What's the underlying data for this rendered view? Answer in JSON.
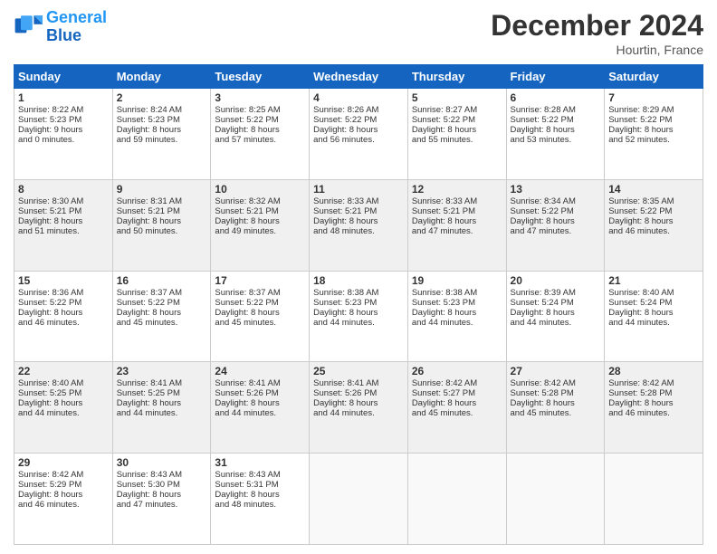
{
  "header": {
    "logo_line1": "General",
    "logo_line2": "Blue",
    "month_title": "December 2024",
    "location": "Hourtin, France"
  },
  "days_of_week": [
    "Sunday",
    "Monday",
    "Tuesday",
    "Wednesday",
    "Thursday",
    "Friday",
    "Saturday"
  ],
  "weeks": [
    [
      {
        "day": "1",
        "lines": [
          "Sunrise: 8:22 AM",
          "Sunset: 5:23 PM",
          "Daylight: 9 hours",
          "and 0 minutes."
        ]
      },
      {
        "day": "2",
        "lines": [
          "Sunrise: 8:24 AM",
          "Sunset: 5:23 PM",
          "Daylight: 8 hours",
          "and 59 minutes."
        ]
      },
      {
        "day": "3",
        "lines": [
          "Sunrise: 8:25 AM",
          "Sunset: 5:22 PM",
          "Daylight: 8 hours",
          "and 57 minutes."
        ]
      },
      {
        "day": "4",
        "lines": [
          "Sunrise: 8:26 AM",
          "Sunset: 5:22 PM",
          "Daylight: 8 hours",
          "and 56 minutes."
        ]
      },
      {
        "day": "5",
        "lines": [
          "Sunrise: 8:27 AM",
          "Sunset: 5:22 PM",
          "Daylight: 8 hours",
          "and 55 minutes."
        ]
      },
      {
        "day": "6",
        "lines": [
          "Sunrise: 8:28 AM",
          "Sunset: 5:22 PM",
          "Daylight: 8 hours",
          "and 53 minutes."
        ]
      },
      {
        "day": "7",
        "lines": [
          "Sunrise: 8:29 AM",
          "Sunset: 5:22 PM",
          "Daylight: 8 hours",
          "and 52 minutes."
        ]
      }
    ],
    [
      {
        "day": "8",
        "lines": [
          "Sunrise: 8:30 AM",
          "Sunset: 5:21 PM",
          "Daylight: 8 hours",
          "and 51 minutes."
        ]
      },
      {
        "day": "9",
        "lines": [
          "Sunrise: 8:31 AM",
          "Sunset: 5:21 PM",
          "Daylight: 8 hours",
          "and 50 minutes."
        ]
      },
      {
        "day": "10",
        "lines": [
          "Sunrise: 8:32 AM",
          "Sunset: 5:21 PM",
          "Daylight: 8 hours",
          "and 49 minutes."
        ]
      },
      {
        "day": "11",
        "lines": [
          "Sunrise: 8:33 AM",
          "Sunset: 5:21 PM",
          "Daylight: 8 hours",
          "and 48 minutes."
        ]
      },
      {
        "day": "12",
        "lines": [
          "Sunrise: 8:33 AM",
          "Sunset: 5:21 PM",
          "Daylight: 8 hours",
          "and 47 minutes."
        ]
      },
      {
        "day": "13",
        "lines": [
          "Sunrise: 8:34 AM",
          "Sunset: 5:22 PM",
          "Daylight: 8 hours",
          "and 47 minutes."
        ]
      },
      {
        "day": "14",
        "lines": [
          "Sunrise: 8:35 AM",
          "Sunset: 5:22 PM",
          "Daylight: 8 hours",
          "and 46 minutes."
        ]
      }
    ],
    [
      {
        "day": "15",
        "lines": [
          "Sunrise: 8:36 AM",
          "Sunset: 5:22 PM",
          "Daylight: 8 hours",
          "and 46 minutes."
        ]
      },
      {
        "day": "16",
        "lines": [
          "Sunrise: 8:37 AM",
          "Sunset: 5:22 PM",
          "Daylight: 8 hours",
          "and 45 minutes."
        ]
      },
      {
        "day": "17",
        "lines": [
          "Sunrise: 8:37 AM",
          "Sunset: 5:22 PM",
          "Daylight: 8 hours",
          "and 45 minutes."
        ]
      },
      {
        "day": "18",
        "lines": [
          "Sunrise: 8:38 AM",
          "Sunset: 5:23 PM",
          "Daylight: 8 hours",
          "and 44 minutes."
        ]
      },
      {
        "day": "19",
        "lines": [
          "Sunrise: 8:38 AM",
          "Sunset: 5:23 PM",
          "Daylight: 8 hours",
          "and 44 minutes."
        ]
      },
      {
        "day": "20",
        "lines": [
          "Sunrise: 8:39 AM",
          "Sunset: 5:24 PM",
          "Daylight: 8 hours",
          "and 44 minutes."
        ]
      },
      {
        "day": "21",
        "lines": [
          "Sunrise: 8:40 AM",
          "Sunset: 5:24 PM",
          "Daylight: 8 hours",
          "and 44 minutes."
        ]
      }
    ],
    [
      {
        "day": "22",
        "lines": [
          "Sunrise: 8:40 AM",
          "Sunset: 5:25 PM",
          "Daylight: 8 hours",
          "and 44 minutes."
        ]
      },
      {
        "day": "23",
        "lines": [
          "Sunrise: 8:41 AM",
          "Sunset: 5:25 PM",
          "Daylight: 8 hours",
          "and 44 minutes."
        ]
      },
      {
        "day": "24",
        "lines": [
          "Sunrise: 8:41 AM",
          "Sunset: 5:26 PM",
          "Daylight: 8 hours",
          "and 44 minutes."
        ]
      },
      {
        "day": "25",
        "lines": [
          "Sunrise: 8:41 AM",
          "Sunset: 5:26 PM",
          "Daylight: 8 hours",
          "and 44 minutes."
        ]
      },
      {
        "day": "26",
        "lines": [
          "Sunrise: 8:42 AM",
          "Sunset: 5:27 PM",
          "Daylight: 8 hours",
          "and 45 minutes."
        ]
      },
      {
        "day": "27",
        "lines": [
          "Sunrise: 8:42 AM",
          "Sunset: 5:28 PM",
          "Daylight: 8 hours",
          "and 45 minutes."
        ]
      },
      {
        "day": "28",
        "lines": [
          "Sunrise: 8:42 AM",
          "Sunset: 5:28 PM",
          "Daylight: 8 hours",
          "and 46 minutes."
        ]
      }
    ],
    [
      {
        "day": "29",
        "lines": [
          "Sunrise: 8:42 AM",
          "Sunset: 5:29 PM",
          "Daylight: 8 hours",
          "and 46 minutes."
        ]
      },
      {
        "day": "30",
        "lines": [
          "Sunrise: 8:43 AM",
          "Sunset: 5:30 PM",
          "Daylight: 8 hours",
          "and 47 minutes."
        ]
      },
      {
        "day": "31",
        "lines": [
          "Sunrise: 8:43 AM",
          "Sunset: 5:31 PM",
          "Daylight: 8 hours",
          "and 48 minutes."
        ]
      },
      null,
      null,
      null,
      null
    ]
  ]
}
